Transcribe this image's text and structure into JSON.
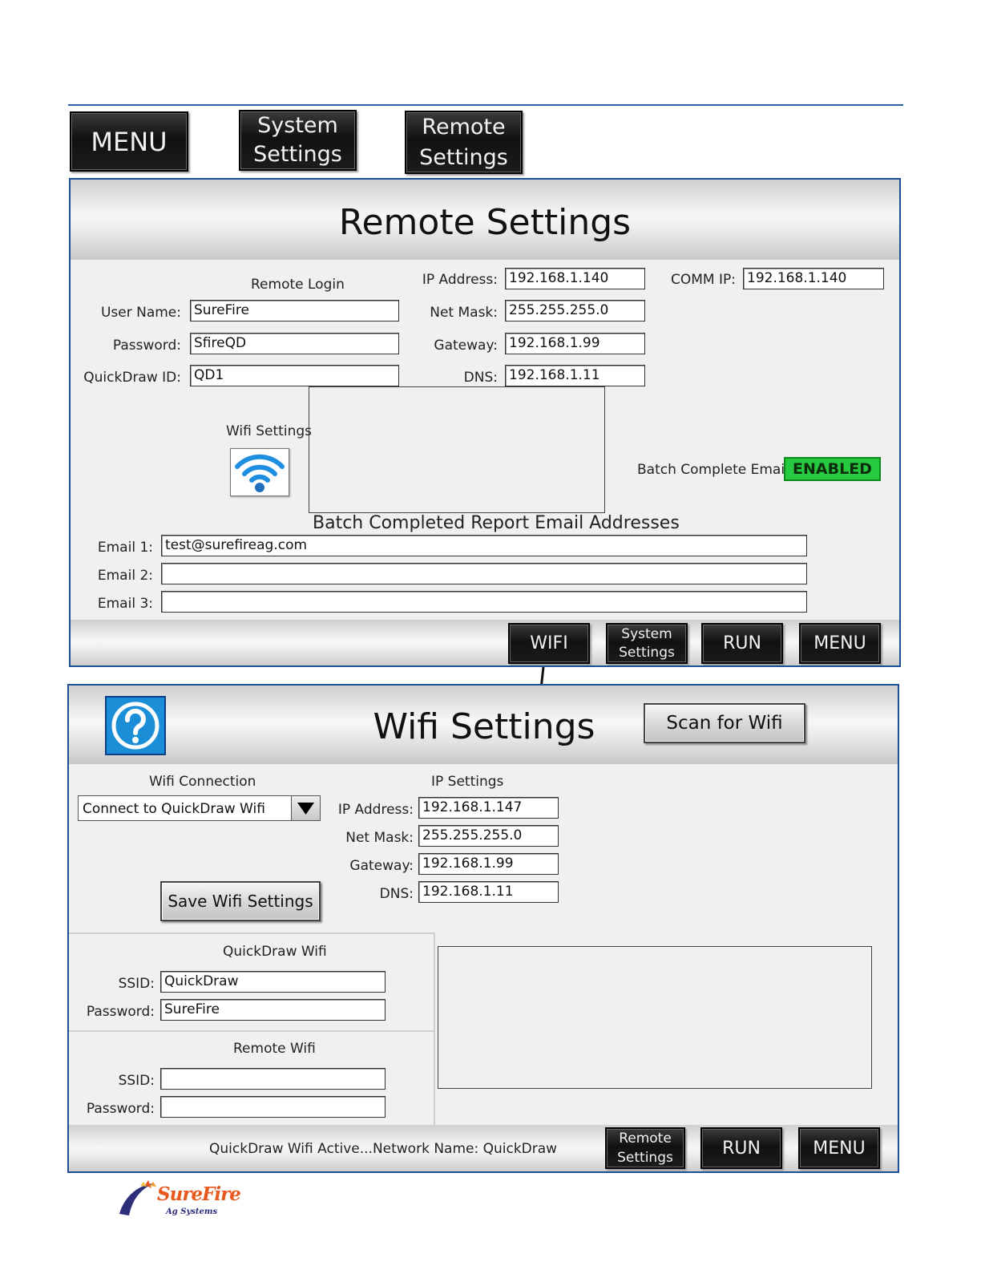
{
  "top_nav": {
    "menu": "MENU",
    "system_settings_1": "System",
    "system_settings_2": "Settings",
    "remote_settings_1": "Remote",
    "remote_settings_2": "Settings"
  },
  "remote_panel": {
    "title": "Remote Settings",
    "remote_login_heading": "Remote Login",
    "user_name_label": "User Name:",
    "user_name_value": "SureFire",
    "password_label": "Password:",
    "password_value": "SfireQD",
    "quickdraw_id_label": "QuickDraw ID:",
    "quickdraw_id_value": "QD1",
    "ip_label": "IP Address:",
    "ip_value": "192.168.1.140",
    "netmask_label": "Net Mask:",
    "netmask_value": "255.255.255.0",
    "gateway_label": "Gateway:",
    "gateway_value": "192.168.1.99",
    "dns_label": "DNS:",
    "dns_value": "192.168.1.11",
    "comm_ip_label": "COMM IP:",
    "comm_ip_value": "192.168.1.140",
    "wifi_settings_label": "Wifi Settings",
    "batch_email_label": "Batch Complete Email",
    "batch_email_status": "ENABLED",
    "batch_report_heading": "Batch Completed Report Email Addresses",
    "emails": [
      {
        "label": "Email 1:",
        "value": "test@surefireag.com"
      },
      {
        "label": "Email 2:",
        "value": ""
      },
      {
        "label": "Email 3:",
        "value": ""
      }
    ],
    "buttons": {
      "wifi": "WIFI",
      "system_1": "System",
      "system_2": "Settings",
      "run": "RUN",
      "menu": "MENU"
    }
  },
  "wifi_panel": {
    "title": "Wifi Settings",
    "scan_button": "Scan for Wifi",
    "wifi_connection_heading": "Wifi Connection",
    "connection_selected": "Connect to QuickDraw Wifi",
    "save_button": "Save Wifi Settings",
    "ip_settings_heading": "IP Settings",
    "ip_label": "IP Address:",
    "ip_value": "192.168.1.147",
    "netmask_label": "Net Mask:",
    "netmask_value": "255.255.255.0",
    "gateway_label": "Gateway:",
    "gateway_value": "192.168.1.99",
    "dns_label": "DNS:",
    "dns_value": "192.168.1.11",
    "quickdraw_wifi_heading": "QuickDraw Wifi",
    "qd_ssid_label": "SSID:",
    "qd_ssid_value": "QuickDraw",
    "qd_password_label": "Password:",
    "qd_password_value": "SureFire",
    "remote_wifi_heading": "Remote Wifi",
    "rw_ssid_label": "SSID:",
    "rw_ssid_value": "",
    "rw_password_label": "Password:",
    "rw_password_value": "",
    "status_text": "QuickDraw Wifi Active...Network Name:  QuickDraw",
    "buttons": {
      "remote_1": "Remote",
      "remote_2": "Settings",
      "run": "RUN",
      "menu": "MENU"
    }
  },
  "logo": {
    "brand": "SureFire",
    "tagline": "Ag Systems"
  },
  "colors": {
    "panel_border": "#1c4e9a",
    "enabled_green": "#27c93f",
    "help_blue": "#1a8fd8",
    "logo_orange": "#e8581c",
    "logo_navy": "#2c2e7a"
  }
}
